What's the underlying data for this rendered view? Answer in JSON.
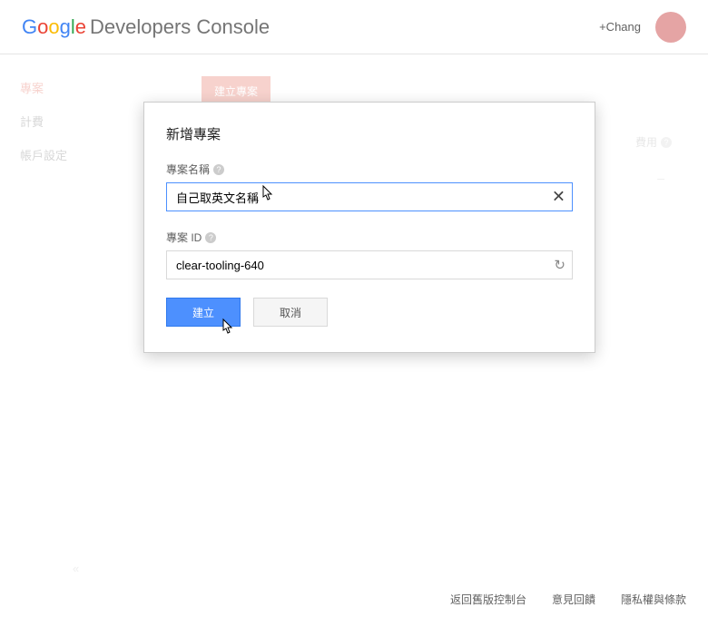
{
  "header": {
    "brand_rest": "Developers Console",
    "user_name": "+Chang"
  },
  "sidebar": {
    "items": [
      {
        "label": "專案",
        "active": true
      },
      {
        "label": "計費",
        "active": false
      },
      {
        "label": "帳戶設定",
        "active": false
      }
    ],
    "collapse_glyph": "«"
  },
  "main": {
    "create_button": "建立專案",
    "fee_label": "費用",
    "fee_value": "–"
  },
  "dialog": {
    "title": "新增專案",
    "name_label": "專案名稱",
    "name_value": "自己取英文名稱",
    "id_label": "專案 ID",
    "id_value": "clear-tooling-640",
    "submit": "建立",
    "cancel": "取消"
  },
  "footer": {
    "items": [
      "返回舊版控制台",
      "意見回饋",
      "隱私權與條款"
    ]
  }
}
